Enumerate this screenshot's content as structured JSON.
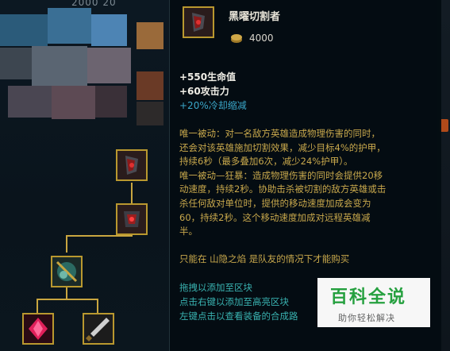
{
  "background": {
    "top_numbers": "2000     20"
  },
  "item": {
    "name": "黑曜切割者",
    "cost": "4000",
    "stats": [
      "+550生命值",
      "+60攻击力",
      "+20%冷却缩减"
    ],
    "passive_1": [
      "唯一被动：对一名敌方英雄造成物理伤害的同时，",
      "还会对该英雄施加切割效果，减少目标4%的护甲，",
      "持续6秒（最多叠加6次，减少24%护甲）。"
    ],
    "passive_2": [
      "唯一被动—狂暴：造成物理伤害的同时会提供20移",
      "动速度，持续2秒。协助击杀被切割的敌方英雄或击",
      "杀任何敌对单位时，提供的移动速度加成会变为",
      "60，持续2秒。这个移动速度加成对远程英雄减",
      "半。"
    ],
    "restriction": "只能在 山隐之焰 是队友的情况下才能购买",
    "hints": [
      "拖拽以添加至区块",
      "点击右键以添加至高亮区块",
      "左键点击以查看装备的合成路"
    ]
  },
  "watermark": {
    "title": "百科全说",
    "subtitle": "助你轻松解决"
  },
  "colors": {
    "gold_text": "#c8a84c",
    "cyan_hint": "#39b2b0",
    "cdr_blue": "#3aa6c8",
    "frame_gold": "#b9982f"
  }
}
